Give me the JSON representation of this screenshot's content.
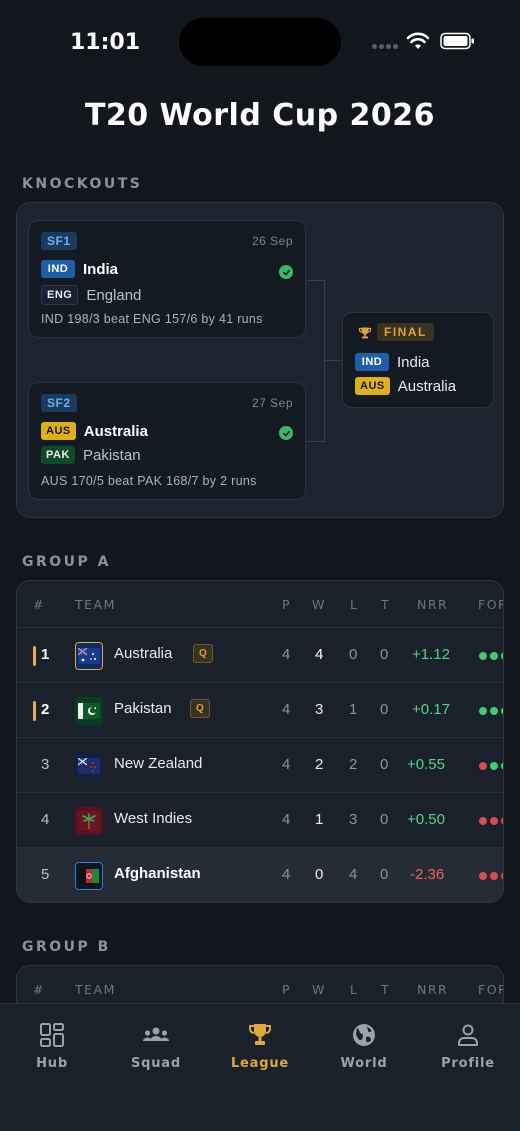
{
  "status": {
    "time": "11:01"
  },
  "title": "T20 World Cup 2026",
  "knockouts": {
    "label": "KNOCKOUTS",
    "semis": [
      {
        "badge": "SF1",
        "date": "26 Sep",
        "teams": [
          {
            "code": "IND",
            "name": "India",
            "winner": true
          },
          {
            "code": "ENG",
            "name": "England",
            "winner": false
          }
        ],
        "result": "IND 198/3 beat ENG 157/6 by 41 runs"
      },
      {
        "badge": "SF2",
        "date": "27 Sep",
        "teams": [
          {
            "code": "AUS",
            "name": "Australia",
            "winner": true
          },
          {
            "code": "PAK",
            "name": "Pakistan",
            "winner": false
          }
        ],
        "result": "AUS 170/5 beat PAK 168/7 by 2 runs"
      }
    ],
    "final": {
      "badge": "FINAL",
      "teams": [
        {
          "code": "IND",
          "name": "India"
        },
        {
          "code": "AUS",
          "name": "Australia"
        }
      ]
    }
  },
  "group_a": {
    "label": "GROUP A",
    "headers": {
      "pos": "#",
      "team": "TEAM",
      "p": "P",
      "w": "W",
      "l": "L",
      "t": "T",
      "nrr": "NRR",
      "form": "FOR"
    },
    "rows": [
      {
        "pos": "1",
        "team": "Australia",
        "qualified": true,
        "q": "Q",
        "p": "4",
        "w": "4",
        "l": "0",
        "t": "0",
        "nrr": "+1.12",
        "form": [
          "W",
          "W",
          "W"
        ]
      },
      {
        "pos": "2",
        "team": "Pakistan",
        "qualified": true,
        "q": "Q",
        "p": "4",
        "w": "3",
        "l": "1",
        "t": "0",
        "nrr": "+0.17",
        "form": [
          "W",
          "W",
          "W"
        ]
      },
      {
        "pos": "3",
        "team": "New Zealand",
        "qualified": false,
        "p": "4",
        "w": "2",
        "l": "2",
        "t": "0",
        "nrr": "+0.55",
        "form": [
          "L",
          "W",
          "W"
        ]
      },
      {
        "pos": "4",
        "team": "West Indies",
        "qualified": false,
        "p": "4",
        "w": "1",
        "l": "3",
        "t": "0",
        "nrr": "+0.50",
        "form": [
          "L",
          "L",
          "L"
        ]
      },
      {
        "pos": "5",
        "team": "Afghanistan",
        "qualified": false,
        "highlight": true,
        "p": "4",
        "w": "0",
        "l": "4",
        "t": "0",
        "nrr": "-2.36",
        "form": [
          "L",
          "L",
          "L"
        ]
      }
    ]
  },
  "group_b": {
    "label": "GROUP B",
    "headers": {
      "pos": "#",
      "team": "TEAM",
      "p": "P",
      "w": "W",
      "l": "L",
      "t": "T",
      "nrr": "NRR",
      "form": "FOR"
    }
  },
  "colors": {
    "win": "#3fcf6e",
    "loss": "#e0484f",
    "accent": "#e0a93a",
    "nrr_pos": "#4fd58a",
    "nrr_neg": "#f06060"
  },
  "tabs": [
    {
      "label": "Hub",
      "icon": "dashboard-icon"
    },
    {
      "label": "Squad",
      "icon": "team-icon"
    },
    {
      "label": "League",
      "icon": "trophy-icon",
      "active": true
    },
    {
      "label": "World",
      "icon": "globe-icon"
    },
    {
      "label": "Profile",
      "icon": "person-icon"
    }
  ]
}
